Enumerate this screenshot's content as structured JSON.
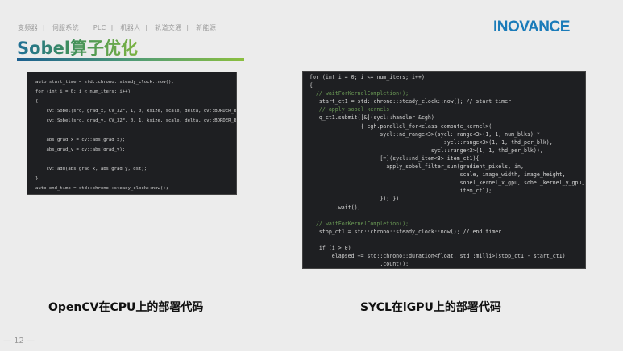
{
  "header": {
    "nav": [
      "变频器",
      "伺服系统",
      "PLC",
      "机器人",
      "轨道交通",
      "新能源"
    ],
    "title": "Sobel算子优化",
    "logo": "INOVANCE"
  },
  "cpu_code": [
    "auto start_time = std::chrono::steady_clock::now();",
    "for (int i = 0; i < num_iters; i++)",
    "{",
    "    cv::Sobel(src, grad_x, CV_32F, 1, 0, ksize, scale, delta, cv::BORDER_REPLICATE);",
    "    cv::Sobel(src, grad_y, CV_32F, 0, 1, ksize, scale, delta, cv::BORDER_REPLICATE);",
    "",
    "    abs_grad_x = cv::abs(grad_x);",
    "    abs_grad_y = cv::abs(grad_y);",
    "",
    "    cv::add(abs_grad_x, abs_grad_y, dst);",
    "}",
    "auto end_time = std::chrono::steady_clock::now();"
  ],
  "gpu_code": [
    "for (int i = 0; i <= num_iters; i++)",
    "{",
    "  // waitForKernelCompletion();",
    "   start_ct1 = std::chrono::steady_clock::now(); // start timer",
    "   // apply sobel kernels",
    "   q_ct1.submit([&](sycl::handler &cgh)",
    "                { cgh.parallel_for<class compute_kernel>(",
    "                      sycl::nd_range<3>(sycl::range<3>(1, 1, num_blks) *",
    "                                          sycl::range<3>(1, 1, thd_per_blk),",
    "                                      sycl::range<3>(1, 1, thd_per_blk)),",
    "                      [=](sycl::nd_item<3> item_ct1){",
    "                        apply_sobel_filter_sum(gradient_pixels, in,",
    "                                               scale, image_width, image_height,",
    "                                               sobel_kernel_x_gpu, sobel_kernel_y_gpu,",
    "                                               item_ct1);",
    "                      }); })",
    "        .wait();",
    "",
    "  // waitForKernelCompletion();",
    "   stop_ct1 = std::chrono::steady_clock::now(); // end timer",
    "",
    "   if (i > 0)",
    "       elapsed += std::chrono::duration<float, std::milli>(stop_ct1 - start_ct1)",
    "                      .count();",
    "}"
  ],
  "captions": {
    "cpu": "OpenCV在CPU上的部署代码",
    "gpu": "SYCL在iGPU上的部署代码"
  },
  "page_number": "— 12 —"
}
